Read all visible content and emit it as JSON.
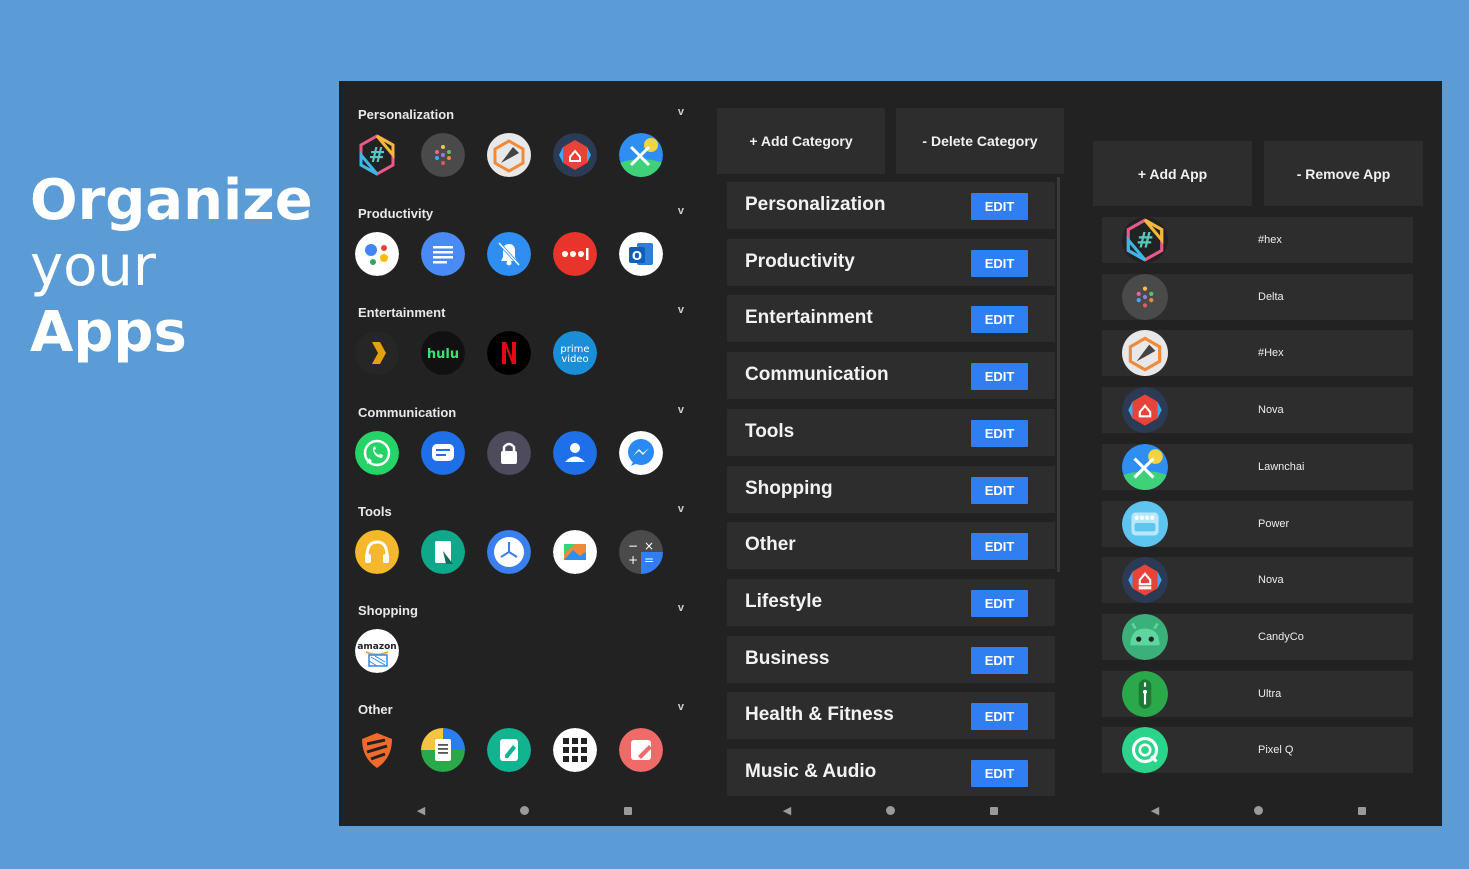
{
  "headline": {
    "line1": "Organize",
    "line2": "your",
    "line3": "Apps"
  },
  "nav": {
    "back": "◀"
  },
  "launcher": {
    "chevron": "v",
    "categories": [
      {
        "title": "Personalization",
        "icons": [
          "hex-icon-app-icon",
          "delta-icon-app-icon",
          "hex-pen-app-icon",
          "nova-launcher-icon",
          "lawnchair-icon"
        ]
      },
      {
        "title": "Productivity",
        "icons": [
          "google-assistant-icon",
          "google-docs-icon",
          "notification-bell-icon",
          "more-dots-icon",
          "outlook-icon"
        ]
      },
      {
        "title": "Entertainment",
        "icons": [
          "plex-icon",
          "hulu-icon",
          "netflix-icon",
          "prime-video-icon"
        ]
      },
      {
        "title": "Communication",
        "icons": [
          "whatsapp-icon",
          "messages-icon",
          "lock-app-icon",
          "contacts-icon",
          "messenger-icon"
        ]
      },
      {
        "title": "Tools",
        "icons": [
          "headphones-icon",
          "bookmark-app-icon",
          "clock-icon",
          "photo-app-icon",
          "calculator-icon"
        ]
      },
      {
        "title": "Shopping",
        "icons": [
          "amazon-shopping-icon"
        ]
      },
      {
        "title": "Other",
        "icons": [
          "blokada-shield-icon",
          "sheets-doc-icon",
          "edit-doc-icon",
          "grid-app-icon",
          "notes-app-icon"
        ]
      }
    ]
  },
  "categories_screen": {
    "add_label": "+ Add Category",
    "delete_label": "- Delete Category",
    "edit_label": "EDIT",
    "items": [
      "Personalization",
      "Productivity",
      "Entertainment",
      "Communication",
      "Tools",
      "Shopping",
      "Other",
      "Lifestyle",
      "Business",
      "Health & Fitness",
      "Music & Audio"
    ]
  },
  "apps_screen": {
    "add_label": "+ Add App",
    "remove_label": "- Remove App",
    "apps": [
      {
        "name": "#hex",
        "icon": "hex-icon-app-icon"
      },
      {
        "name": "Delta",
        "icon": "delta-icon-app-icon"
      },
      {
        "name": "#Hex",
        "icon": "hex-pen-app-icon"
      },
      {
        "name": "Nova",
        "icon": "nova-launcher-icon"
      },
      {
        "name": "Lawnchai",
        "icon": "lawnchair-icon"
      },
      {
        "name": "Power",
        "icon": "power-app-icon"
      },
      {
        "name": "Nova",
        "icon": "nova-prime-icon"
      },
      {
        "name": "CandyCo",
        "icon": "candy-android-icon"
      },
      {
        "name": "Ultra",
        "icon": "ultra-volume-icon"
      },
      {
        "name": "Pixel Q",
        "icon": "pixel-q-icon"
      }
    ]
  }
}
